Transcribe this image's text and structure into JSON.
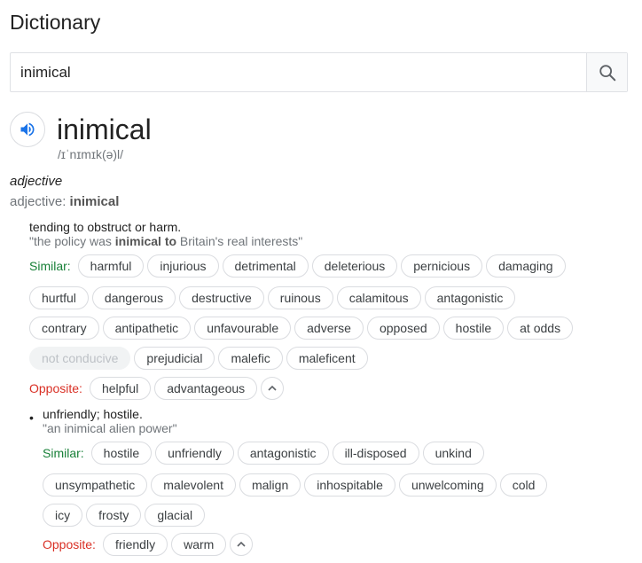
{
  "header": {
    "title": "Dictionary"
  },
  "search": {
    "value": "inimical",
    "button_icon": "search-icon"
  },
  "entry": {
    "word": "inimical",
    "phonetic": "/ɪˈnɪmɪk(ə)l/",
    "pos": "adjective",
    "forms_prefix": "adjective: ",
    "forms_word": "inimical"
  },
  "senses": [
    {
      "definition": "tending to obstruct or harm.",
      "example_before": "\"the policy was ",
      "example_bold": "inimical to",
      "example_after": " Britain's real interests\"",
      "similar_label": "Similar:",
      "similar_rows": [
        [
          "harmful",
          "injurious",
          "detrimental",
          "deleterious",
          "pernicious",
          "damaging"
        ],
        [
          "hurtful",
          "dangerous",
          "destructive",
          "ruinous",
          "calamitous",
          "antagonistic"
        ],
        [
          "contrary",
          "antipathetic",
          "unfavourable",
          "adverse",
          "opposed",
          "hostile",
          "at odds"
        ],
        [
          "not conducive",
          "prejudicial",
          "malefic",
          "maleficent"
        ]
      ],
      "opposite_label": "Opposite:",
      "opposites": [
        "helpful",
        "advantageous"
      ]
    },
    {
      "bullet": "•",
      "definition": "unfriendly; hostile.",
      "example": "\"an inimical alien power\"",
      "similar_label": "Similar:",
      "similar_rows": [
        [
          "hostile",
          "unfriendly",
          "antagonistic",
          "ill-disposed",
          "unkind"
        ],
        [
          "unsympathetic",
          "malevolent",
          "malign",
          "inhospitable",
          "unwelcoming",
          "cold"
        ],
        [
          "icy",
          "frosty",
          "glacial"
        ]
      ],
      "opposite_label": "Opposite:",
      "opposites": [
        "friendly",
        "warm"
      ]
    }
  ],
  "colors": {
    "similar": "#188038",
    "opposite": "#d93025",
    "speaker": "#1a73e8"
  }
}
